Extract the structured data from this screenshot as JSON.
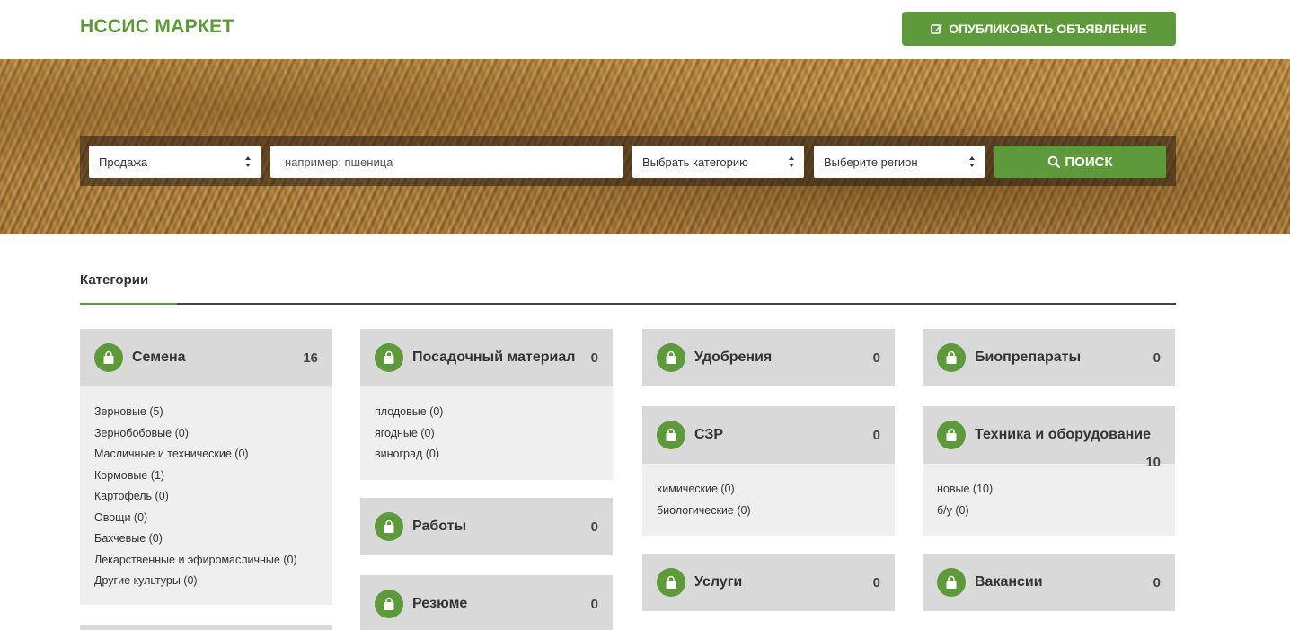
{
  "header": {
    "logo": "НССИС МАРКЕТ",
    "publish_label": "ОПУБЛИКОВАТЬ ОБЪЯВЛЕНИЕ"
  },
  "search": {
    "type_value": "Продажа",
    "query_placeholder": "например: пшеница",
    "category_value": "Выбрать категорию",
    "region_value": "Выберите регион",
    "button_label": "ПОИСК"
  },
  "categories": {
    "title": "Категории",
    "semena": {
      "name": "Семена",
      "count": "16",
      "items": [
        "Зерновые (5)",
        "Зернобобовые (0)",
        "Масличные и технические (0)",
        "Кормовые (1)",
        "Картофель (0)",
        "Овощи (0)",
        "Бахчевые (0)",
        "Лекарственные и эфиромасличные (0)",
        "Другие культуры (0)"
      ]
    },
    "posad": {
      "name": "Посадочный материал",
      "count": "0",
      "items": [
        "плодовые (0)",
        "ягодные (0)",
        "виноград (0)"
      ]
    },
    "raboty": {
      "name": "Работы",
      "count": "0"
    },
    "rezume": {
      "name": "Резюме",
      "count": "0"
    },
    "udobr": {
      "name": "Удобрения",
      "count": "0"
    },
    "szr": {
      "name": "СЗР",
      "count": "0",
      "items": [
        "химические (0)",
        "биологические (0)"
      ]
    },
    "uslugi": {
      "name": "Услуги",
      "count": "0"
    },
    "bio": {
      "name": "Биопрепараты",
      "count": "0"
    },
    "tehnika": {
      "name": "Техника и оборудование",
      "count": "10",
      "items": [
        "новые (10)",
        "б/у (0)"
      ]
    },
    "vakansii": {
      "name": "Вакансии",
      "count": "0"
    }
  },
  "colors": {
    "accent": "#5e9a3c",
    "card_head": "#d9d9d9",
    "card_body": "#efefef"
  },
  "icons": {
    "publish": "edit-icon",
    "search": "search-icon",
    "category": "shopping-bag-icon"
  }
}
